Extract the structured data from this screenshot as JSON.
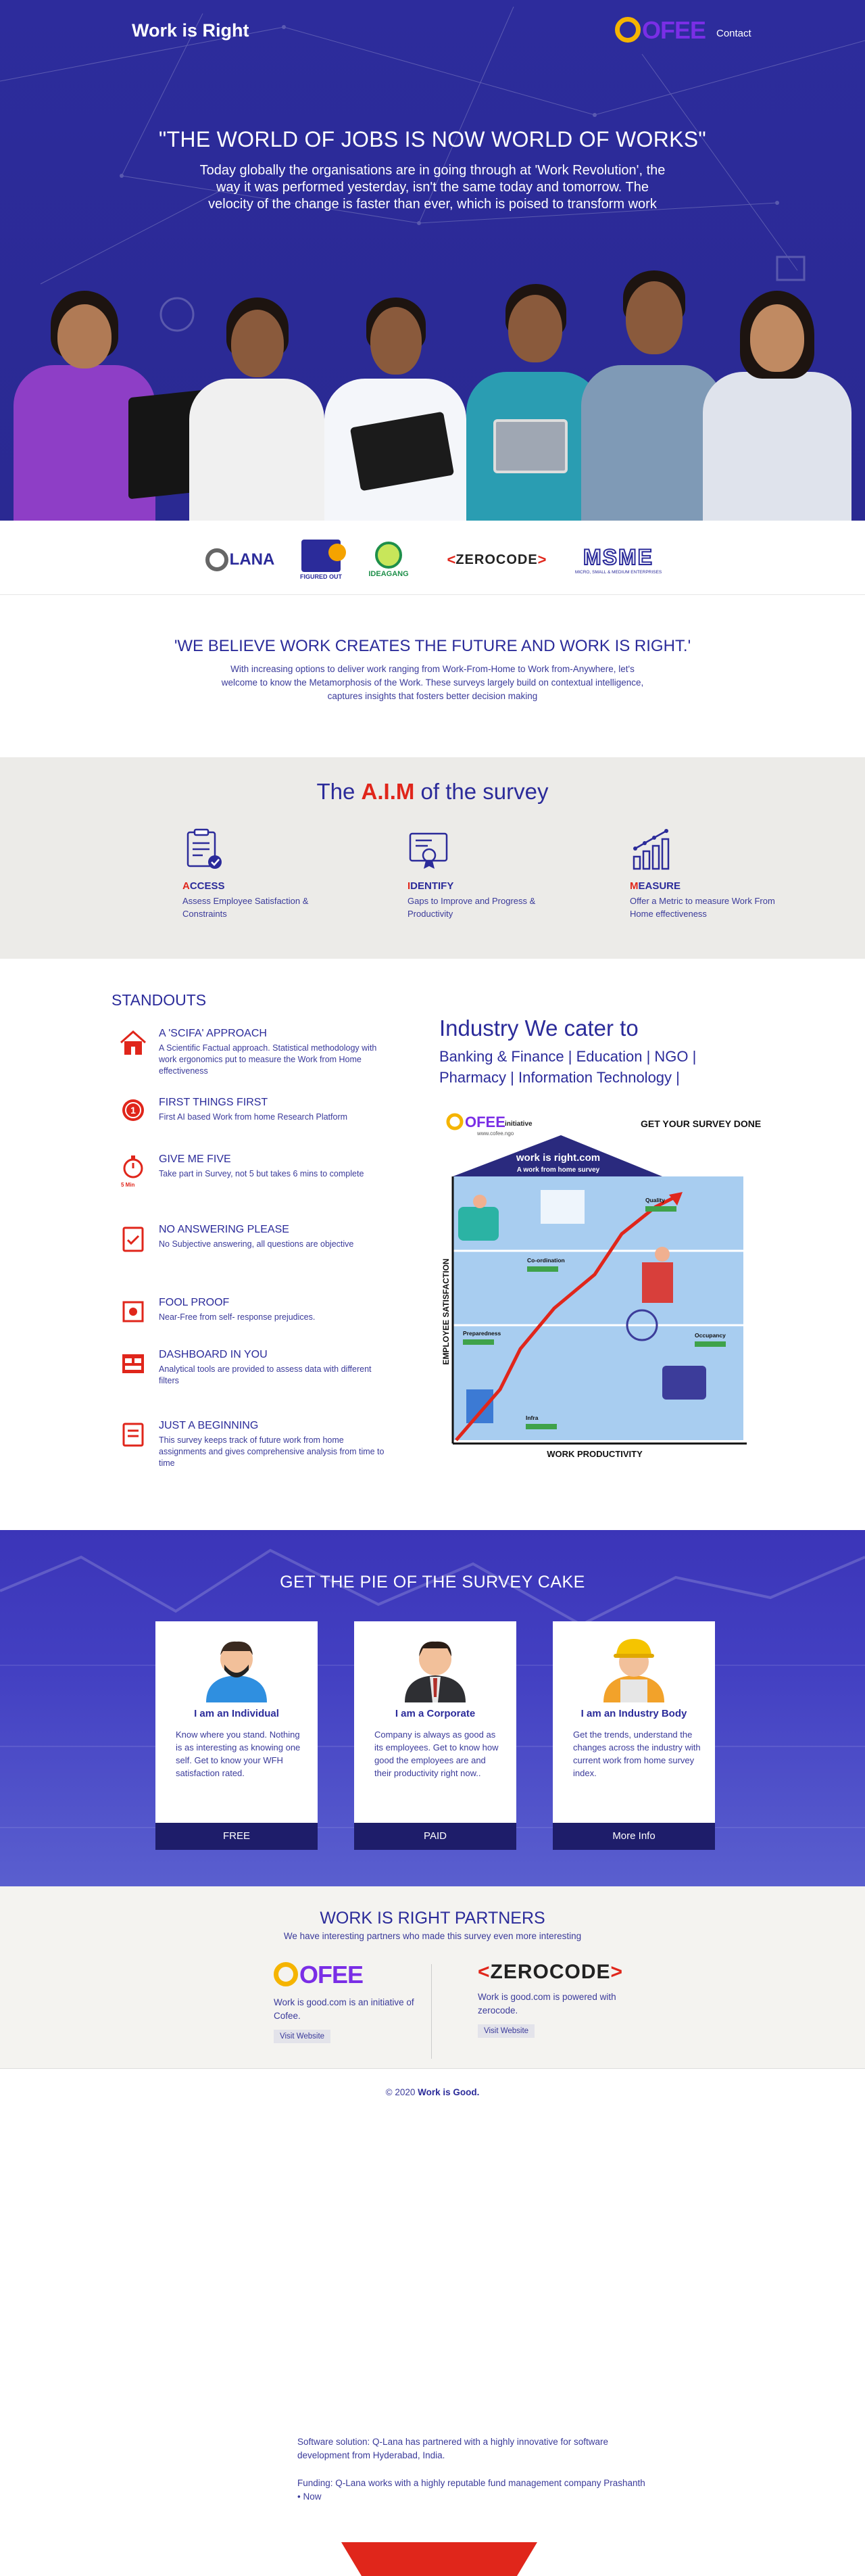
{
  "header": {
    "brand": "Work is Right",
    "logo_text": "OFEE",
    "contact": "Contact"
  },
  "hero": {
    "title": "\"THE WORLD OF JOBS IS NOW WORLD OF WORKS\"",
    "text": "Today globally the organisations are in going through at 'Work Revolution', the way it was performed yesterday, isn't the same today and tomorrow. The velocity of the change is faster than ever, which is poised to transform work"
  },
  "partner_logos": {
    "qlana": "LANA",
    "figured_out": "FIGURED OUT",
    "ideagang": "IDEAGANG",
    "zerocode": "ZEROCODE",
    "msme": "MSME",
    "msme_sub": "MICRO, SMALL & MEDIUM ENTERPRISES"
  },
  "believe": {
    "title": "'WE BELIEVE WORK CREATES THE FUTURE AND WORK IS RIGHT.'",
    "text": "With increasing options to deliver work ranging from Work-From-Home to Work from-Anywhere, let's welcome to know the Metamorphosis of the Work. These surveys largely build on contextual intelligence, captures insights that fosters better decision making"
  },
  "aim": {
    "title_pre": "The ",
    "title_red": "A.I.M",
    "title_post": " of the survey",
    "items": [
      {
        "first": "A",
        "rest": "CCESS",
        "text": "Assess Employee Satisfaction & Constraints"
      },
      {
        "first": "I",
        "rest": "DENTIFY",
        "text": "Gaps to Improve and Progress & Productivity"
      },
      {
        "first": "M",
        "rest": "EASURE",
        "text": "Offer a Metric to measure Work From Home effectiveness"
      }
    ]
  },
  "standouts": {
    "title": "STANDOUTS",
    "items": [
      {
        "title": "A 'SCIFA' APPROACH",
        "text": "A Scientific Factual approach. Statistical methodology with work ergonomics put to measure the Work from Home effectiveness"
      },
      {
        "title": "FIRST THINGS FIRST",
        "text": "First AI based Work from home Research Platform"
      },
      {
        "title": "GIVE ME FIVE",
        "text": "Take part in Survey, not 5 but takes 6 mins to complete",
        "icon_label": "5 Min"
      },
      {
        "title": "NO ANSWERING PLEASE",
        "text": "No Subjective answering, all questions are objective"
      },
      {
        "title": "FOOL PROOF",
        "text": "Near-Free from self- response prejudices."
      },
      {
        "title": "DASHBOARD IN YOU",
        "text": "Analytical tools are provided to assess data with different filters"
      },
      {
        "title": "JUST A BEGINNING",
        "text": "This survey keeps track of future work from home assignments and gives comprehensive analysis from time to time"
      }
    ]
  },
  "industry": {
    "title": "Industry We cater to",
    "sectors": "Banking & Finance | Education | NGO | Pharmacy | Information Technology |"
  },
  "infographic": {
    "logo": "OFEE",
    "initiative": "initiative",
    "url": "www.cofee.ngo",
    "cta": "GET YOUR SURVEY DONE",
    "roof_title": "work is right.com",
    "roof_sub": "A work from home survey",
    "y_axis": "EMPLOYEE SATISFACTION",
    "x_axis": "WORK PRODUCTIVITY",
    "labels": [
      "Quality",
      "Co-ordination",
      "Preparedness",
      "Occupancy",
      "Infra"
    ]
  },
  "pie": {
    "title": "GET THE PIE OF THE SURVEY CAKE",
    "cards": [
      {
        "title": "I am an Individual",
        "text": "Know where you stand. Nothing is as interesting as knowing one self. Get to know your WFH satisfaction rated.",
        "button": "FREE"
      },
      {
        "title": "I am a Corporate",
        "text": "Company is always as good as its employees. Get to know how good the employees are and their productivity right now..",
        "button": "PAID"
      },
      {
        "title": "I am an Industry Body",
        "text": "Get the trends, understand the changes across the industry with current work from home survey index.",
        "button": "More Info"
      }
    ]
  },
  "partners": {
    "title": "WORK IS RIGHT PARTNERS",
    "subtitle": "We have interesting partners who made this survey even more interesting",
    "items": [
      {
        "logo": "OFEE",
        "text": "Work is good.com is an initiative of Cofee.",
        "button": "Visit Website"
      },
      {
        "logo": "ZEROCODE",
        "text": "Work is good.com is powered with zerocode.",
        "button": "Visit Website"
      }
    ]
  },
  "footer": {
    "copyright_pre": "© 2020 ",
    "copyright_brand": "Work is Good.",
    "note1": "Software solution: Q-Lana has partnered with a highly innovative for software development from Hyderabad, India.",
    "note2": "Funding: Q-Lana works with a highly reputable fund management company Prashanth • Now"
  },
  "colors": {
    "primary": "#2b2b9a",
    "hero_bg": "#2d2c9c",
    "accent_red": "#e0261b",
    "button_dark": "#1e1d6a",
    "cofee_purple": "#7a2ee6",
    "cofee_yellow": "#f5b400"
  }
}
